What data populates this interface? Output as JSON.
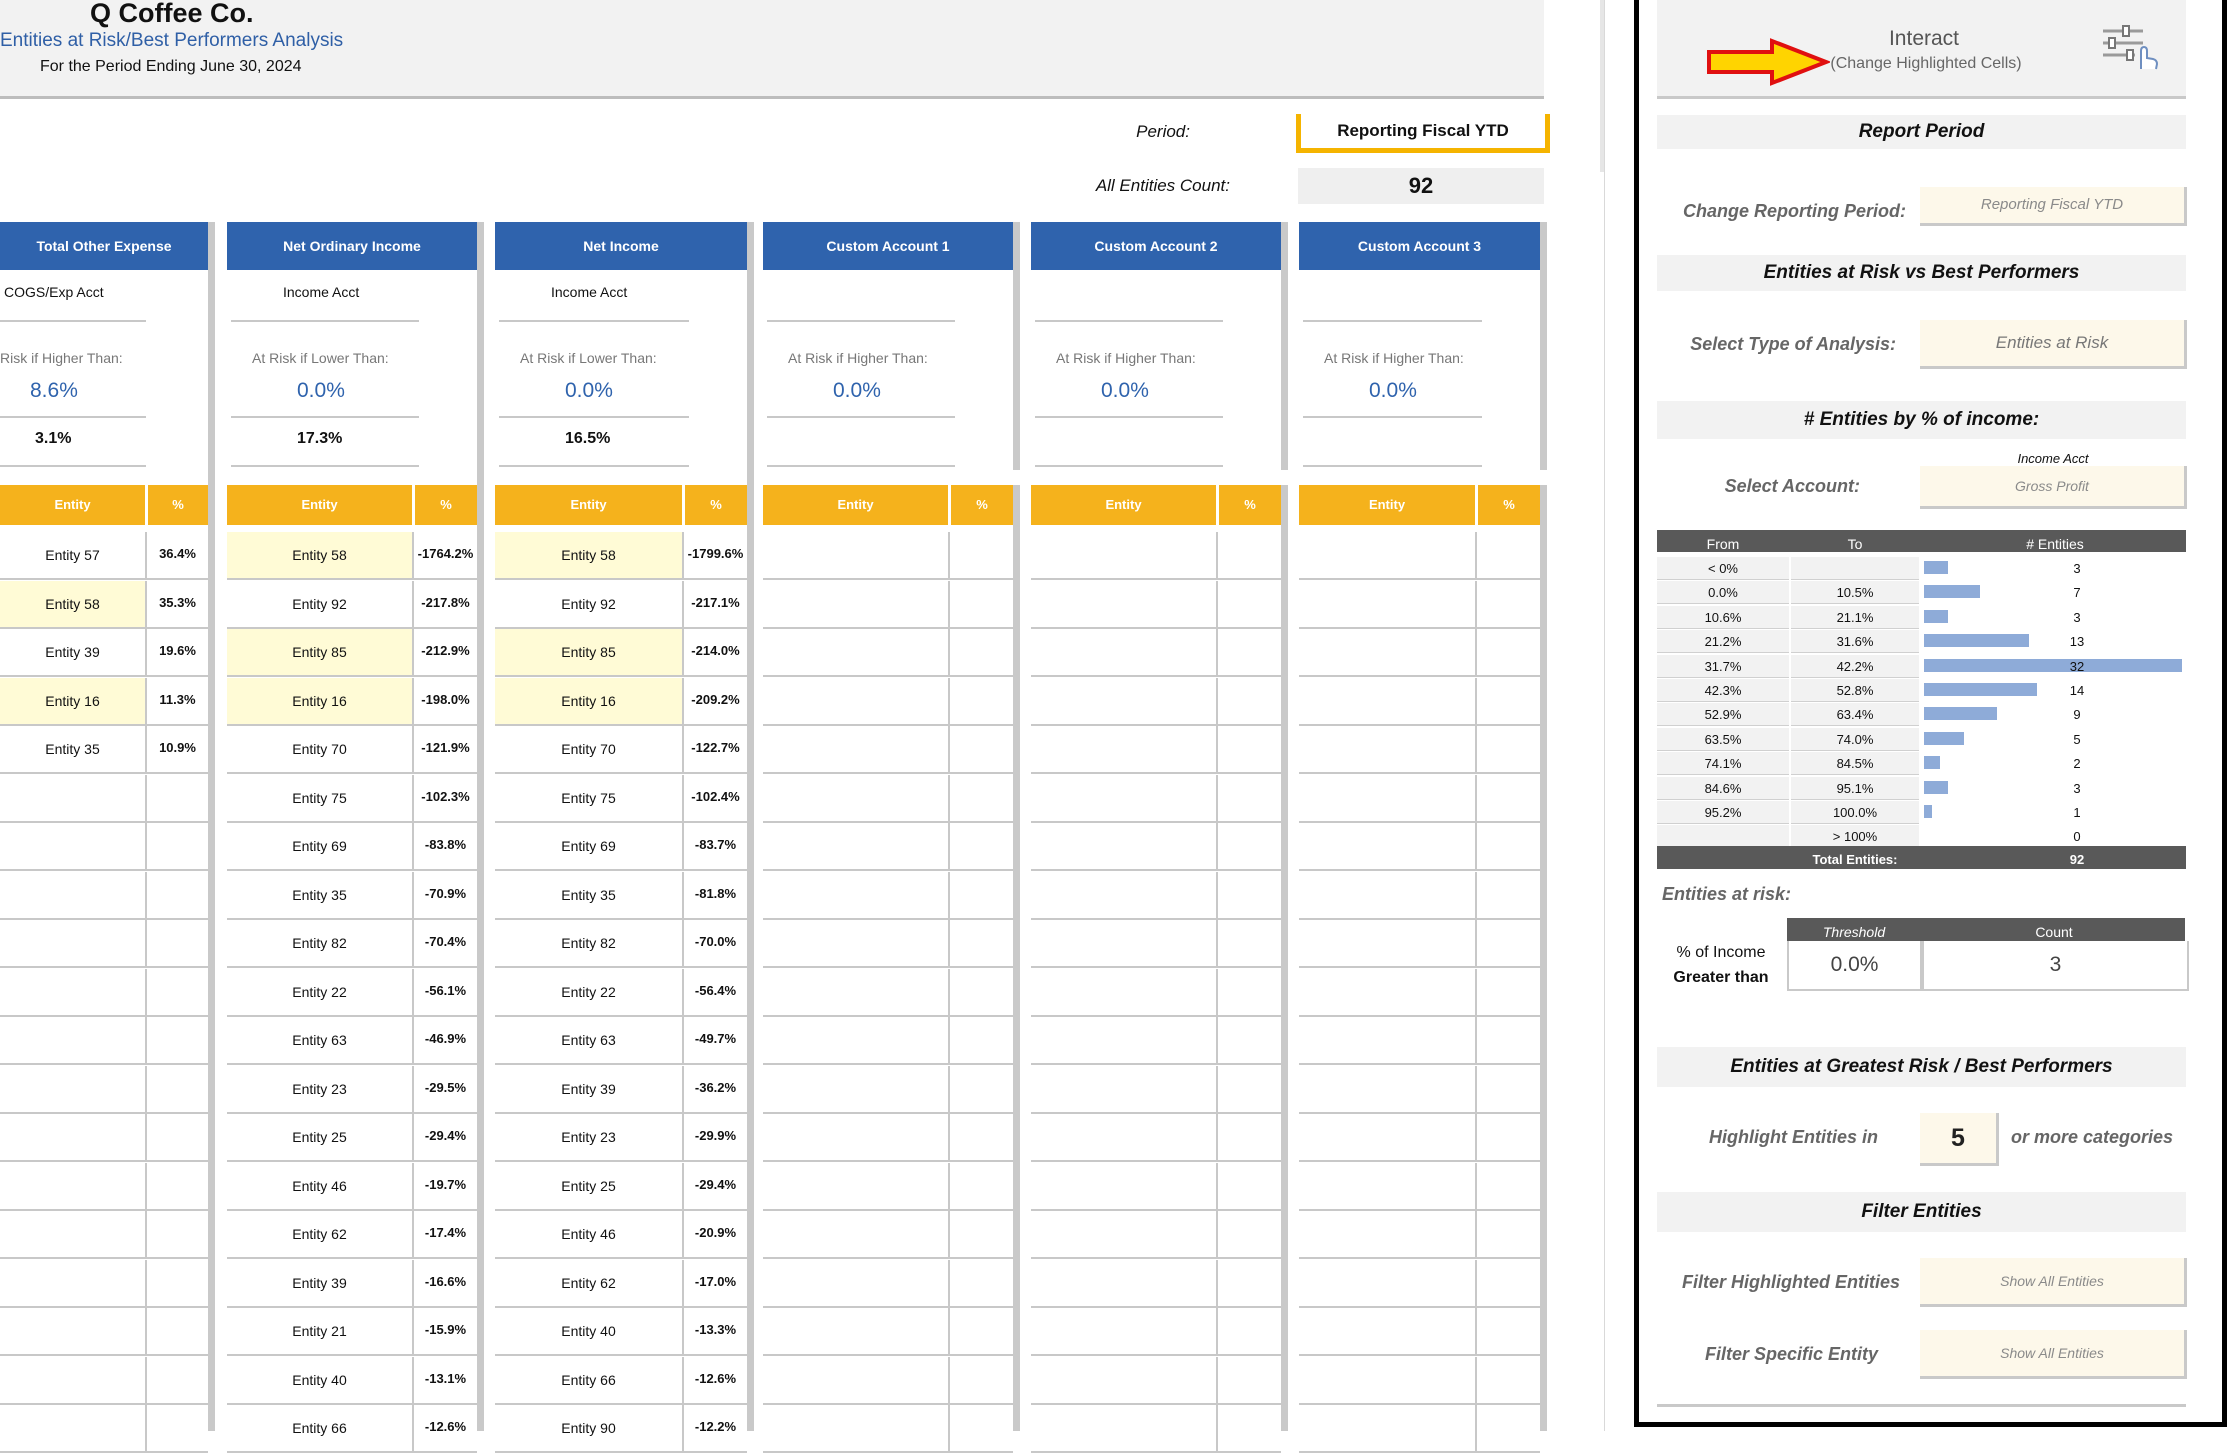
{
  "header": {
    "company": "Q Coffee Co.",
    "subtitle": "Entities at Risk/Best Performers Analysis",
    "period_line": "For the Period Ending June 30, 2024",
    "period_label": "Period:",
    "period_value": "Reporting Fiscal YTD",
    "count_label": "All Entities Count:",
    "count_value": "92"
  },
  "columns": [
    {
      "title": "Total Other Expense",
      "acct": "COGS/Exp Acct",
      "risk_label": "Risk if Higher Than:",
      "risk_value": "8.6%",
      "second_value": "3.1%",
      "entity_header": "Entity",
      "pct_header": "%",
      "rows": [
        [
          "Entity 57",
          "36.4%",
          false
        ],
        [
          "Entity 58",
          "35.3%",
          true
        ],
        [
          "Entity 39",
          "19.6%",
          false
        ],
        [
          "Entity 16",
          "11.3%",
          true
        ],
        [
          "Entity 35",
          "10.9%",
          false
        ]
      ]
    },
    {
      "title": "Net Ordinary Income",
      "acct": "Income Acct",
      "risk_label": "At Risk if Lower Than:",
      "risk_value": "0.0%",
      "second_value": "17.3%",
      "entity_header": "Entity",
      "pct_header": "%",
      "rows": [
        [
          "Entity 58",
          "-1764.2%",
          true
        ],
        [
          "Entity 92",
          "-217.8%",
          false
        ],
        [
          "Entity 85",
          "-212.9%",
          true
        ],
        [
          "Entity 16",
          "-198.0%",
          true
        ],
        [
          "Entity 70",
          "-121.9%",
          false
        ],
        [
          "Entity 75",
          "-102.3%",
          false
        ],
        [
          "Entity 69",
          "-83.8%",
          false
        ],
        [
          "Entity 35",
          "-70.9%",
          false
        ],
        [
          "Entity 82",
          "-70.4%",
          false
        ],
        [
          "Entity 22",
          "-56.1%",
          false
        ],
        [
          "Entity 63",
          "-46.9%",
          false
        ],
        [
          "Entity 23",
          "-29.5%",
          false
        ],
        [
          "Entity 25",
          "-29.4%",
          false
        ],
        [
          "Entity 46",
          "-19.7%",
          false
        ],
        [
          "Entity 62",
          "-17.4%",
          false
        ],
        [
          "Entity 39",
          "-16.6%",
          false
        ],
        [
          "Entity 21",
          "-15.9%",
          false
        ],
        [
          "Entity 40",
          "-13.1%",
          false
        ],
        [
          "Entity 66",
          "-12.6%",
          false
        ]
      ]
    },
    {
      "title": "Net Income",
      "acct": "Income Acct",
      "risk_label": "At Risk if Lower Than:",
      "risk_value": "0.0%",
      "second_value": "16.5%",
      "entity_header": "Entity",
      "pct_header": "%",
      "rows": [
        [
          "Entity 58",
          "-1799.6%",
          true
        ],
        [
          "Entity 92",
          "-217.1%",
          false
        ],
        [
          "Entity 85",
          "-214.0%",
          true
        ],
        [
          "Entity 16",
          "-209.2%",
          true
        ],
        [
          "Entity 70",
          "-122.7%",
          false
        ],
        [
          "Entity 75",
          "-102.4%",
          false
        ],
        [
          "Entity 69",
          "-83.7%",
          false
        ],
        [
          "Entity 35",
          "-81.8%",
          false
        ],
        [
          "Entity 82",
          "-70.0%",
          false
        ],
        [
          "Entity 22",
          "-56.4%",
          false
        ],
        [
          "Entity 63",
          "-49.7%",
          false
        ],
        [
          "Entity 39",
          "-36.2%",
          false
        ],
        [
          "Entity 23",
          "-29.9%",
          false
        ],
        [
          "Entity 25",
          "-29.4%",
          false
        ],
        [
          "Entity 46",
          "-20.9%",
          false
        ],
        [
          "Entity 62",
          "-17.0%",
          false
        ],
        [
          "Entity 40",
          "-13.3%",
          false
        ],
        [
          "Entity 66",
          "-12.6%",
          false
        ],
        [
          "Entity 90",
          "-12.2%",
          false
        ]
      ]
    },
    {
      "title": "Custom Account 1",
      "acct": "",
      "risk_label": "At Risk if Higher Than:",
      "risk_value": "0.0%",
      "second_value": "",
      "entity_header": "Entity",
      "pct_header": "%",
      "rows": []
    },
    {
      "title": "Custom Account 2",
      "acct": "",
      "risk_label": "At Risk if Higher Than:",
      "risk_value": "0.0%",
      "second_value": "",
      "entity_header": "Entity",
      "pct_header": "%",
      "rows": []
    },
    {
      "title": "Custom Account 3",
      "acct": "",
      "risk_label": "At Risk if Higher Than:",
      "risk_value": "0.0%",
      "second_value": "",
      "entity_header": "Entity",
      "pct_header": "%",
      "rows": []
    }
  ],
  "panel": {
    "interact_title": "Interact",
    "interact_sub": "(Change Highlighted Cells)",
    "report_period_title": "Report Period",
    "change_period_label": "Change Reporting Period:",
    "change_period_value": "Reporting Fiscal YTD",
    "analysis_title": "Entities at Risk vs Best Performers",
    "analysis_label": "Select Type of Analysis:",
    "analysis_value": "Entities at Risk",
    "income_title": "# Entities by % of income:",
    "account_caption": "Income Acct",
    "account_label": "Select Account:",
    "account_value": "Gross Profit",
    "hist_headers": {
      "from": "From",
      "to": "To",
      "count": "# Entities"
    },
    "hist_rows": [
      {
        "from": "< 0%",
        "to": "",
        "count": 3
      },
      {
        "from": "0.0%",
        "to": "10.5%",
        "count": 7
      },
      {
        "from": "10.6%",
        "to": "21.1%",
        "count": 3
      },
      {
        "from": "21.2%",
        "to": "31.6%",
        "count": 13
      },
      {
        "from": "31.7%",
        "to": "42.2%",
        "count": 32
      },
      {
        "from": "42.3%",
        "to": "52.8%",
        "count": 14
      },
      {
        "from": "52.9%",
        "to": "63.4%",
        "count": 9
      },
      {
        "from": "63.5%",
        "to": "74.0%",
        "count": 5
      },
      {
        "from": "74.1%",
        "to": "84.5%",
        "count": 2
      },
      {
        "from": "84.6%",
        "to": "95.1%",
        "count": 3
      },
      {
        "from": "95.2%",
        "to": "100.0%",
        "count": 1
      },
      {
        "from": "",
        "to": "> 100%",
        "count": 0
      }
    ],
    "total_label": "Total Entities:",
    "total_value": "92",
    "at_risk_label": "Entities at risk:",
    "threshold_header": "Threshold",
    "count_header": "Count",
    "pct_income_label": "% of Income",
    "greater_than_label": "Greater than",
    "threshold_value": "0.0%",
    "count_value": "3",
    "greatest_title": "Entities at Greatest Risk / Best Performers",
    "highlight_label": "Highlight Entities in",
    "highlight_value": "5",
    "highlight_suffix": "or more categories",
    "filter_title": "Filter Entities",
    "filter_highlighted_label": "Filter Highlighted Entities",
    "filter_highlighted_value": "Show All Entities",
    "filter_specific_label": "Filter Specific Entity",
    "filter_specific_value": "Show All Entities"
  },
  "colors": {
    "blue": "#2f63ad",
    "orange": "#f5b21c",
    "highlight": "#fffbd6",
    "bar": "#8eabd8"
  }
}
